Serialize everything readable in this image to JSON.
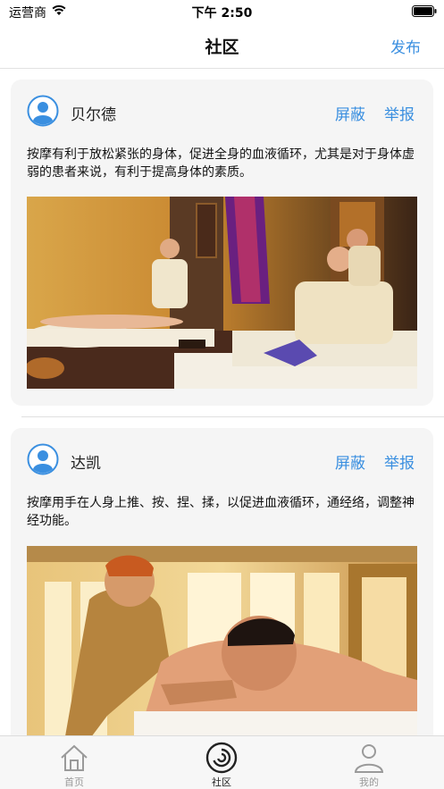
{
  "status_bar": {
    "carrier": "运营商",
    "time": "下午 2:50"
  },
  "nav": {
    "title": "社区",
    "publish_label": "发布"
  },
  "posts": [
    {
      "username": "贝尔德",
      "block_label": "屏蔽",
      "report_label": "举报",
      "text": "按摩有利于放松紧张的身体，促进全身的血液循环，尤其是对于身体虚弱的患者来说，有利于提高身体的素质。",
      "image_icon": "spa-massage-photo"
    },
    {
      "username": "达凯",
      "block_label": "屏蔽",
      "report_label": "举报",
      "text": "按摩用手在人身上推、按、捏、揉，以促进血液循环，通经络，调整神经功能。",
      "image_icon": "back-massage-photo"
    }
  ],
  "tabs": [
    {
      "label": "首页",
      "icon": "home-icon",
      "active": false
    },
    {
      "label": "社区",
      "icon": "community-icon",
      "active": true
    },
    {
      "label": "我的",
      "icon": "profile-icon",
      "active": false
    }
  ],
  "colors": {
    "accent": "#3a8fe0",
    "card_bg": "#f5f5f5",
    "tab_inactive": "#9a9a9a"
  }
}
